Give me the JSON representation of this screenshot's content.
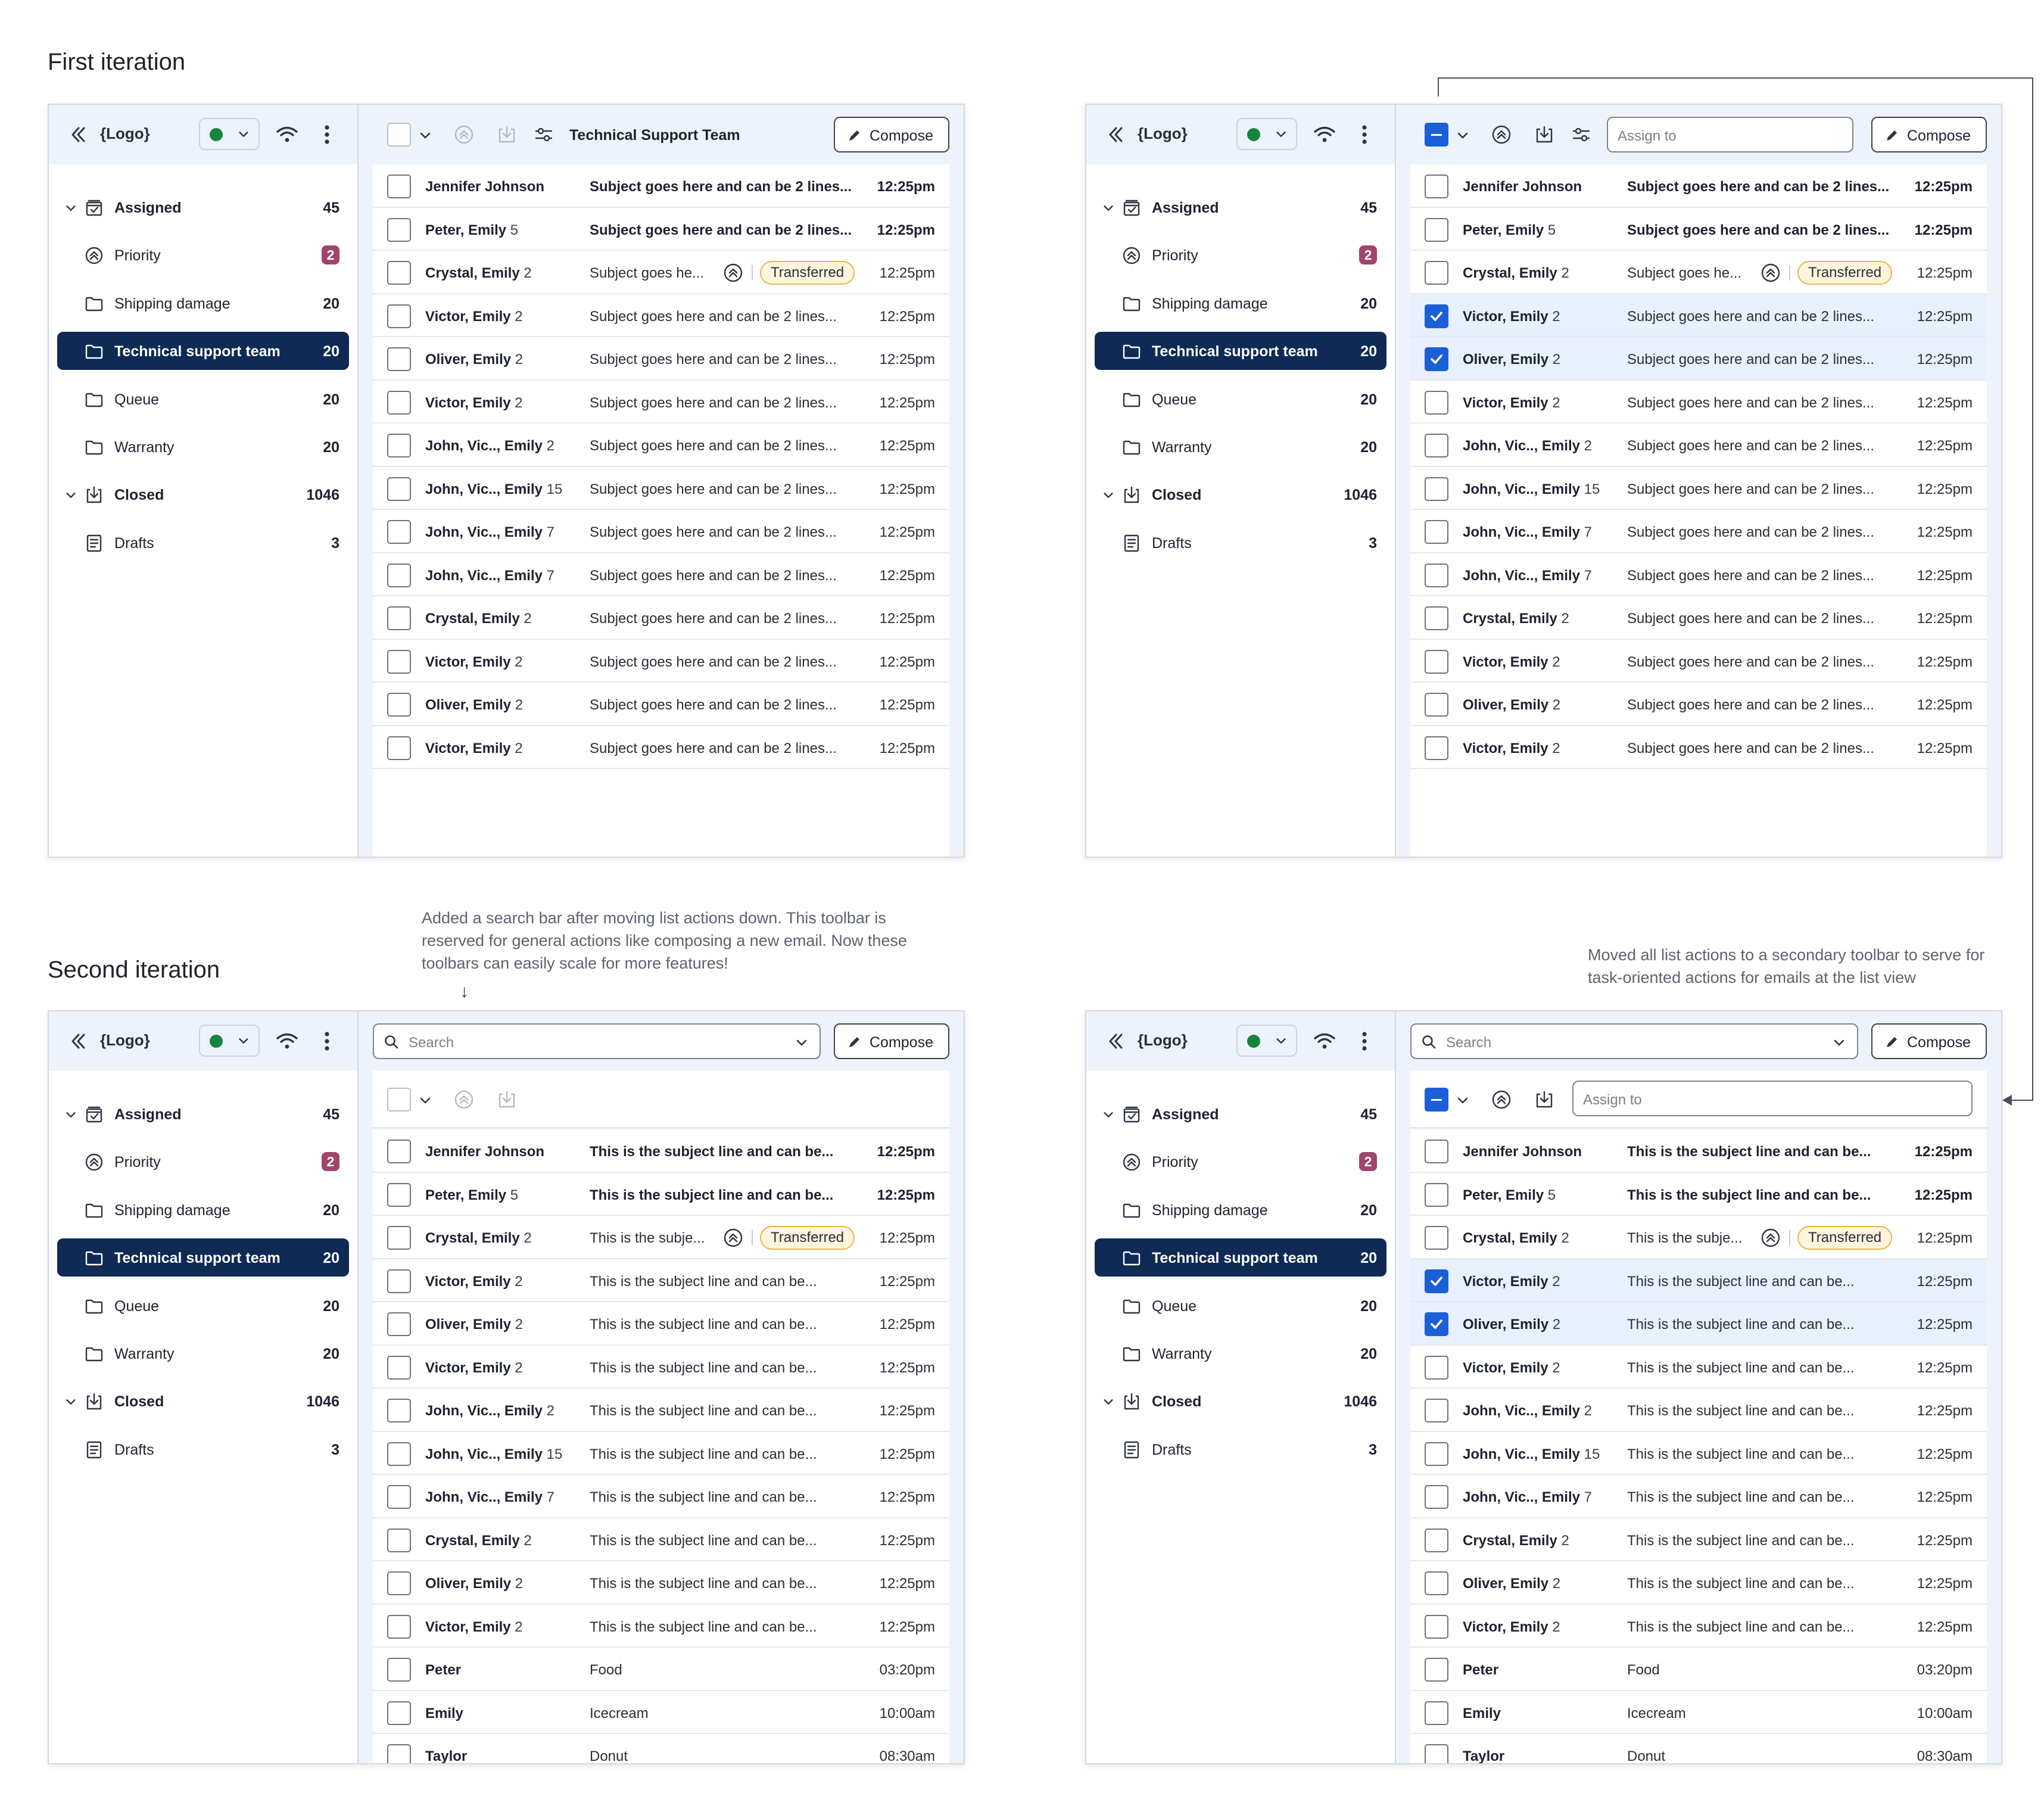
{
  "headings": {
    "first": "First iteration",
    "second": "Second iteration"
  },
  "notes": {
    "search": "Added a search bar after moving list actions down. This toolbar is reserved for general actions like composing a new email. Now these toolbars can easily scale for more features!",
    "toolbar": "Moved all list actions to a secondary toolbar to serve for task-oriented actions for emails at the list view",
    "arrow": "↓"
  },
  "app": {
    "logo": "{Logo}",
    "compose": "Compose",
    "team_title": "Technical Support Team",
    "assign_placeholder": "Assign to",
    "search_placeholder": "Search",
    "badge": "Transferred",
    "status_color": "#17843b",
    "accent": "#1b5fd6",
    "nav_active": "#0e2a55"
  },
  "nav": [
    {
      "label": "Assigned",
      "count": "45",
      "icon": "inbox-icon",
      "kind": "root"
    },
    {
      "label": "Priority",
      "count": "2",
      "icon": "priority-icon",
      "kind": "child",
      "pill": true
    },
    {
      "label": "Shipping damage",
      "count": "20",
      "icon": "folder-icon",
      "kind": "child"
    },
    {
      "label": "Technical support team",
      "count": "20",
      "icon": "folder-icon",
      "kind": "child",
      "active": true
    },
    {
      "label": "Queue",
      "count": "20",
      "icon": "folder-icon",
      "kind": "child"
    },
    {
      "label": "Warranty",
      "count": "20",
      "icon": "folder-icon",
      "kind": "child"
    },
    {
      "label": "Closed",
      "count": "1046",
      "icon": "archive-icon",
      "kind": "root"
    },
    {
      "label": "Drafts",
      "count": "3",
      "icon": "drafts-icon",
      "kind": "plain"
    }
  ],
  "emails_first": [
    {
      "sender": "Jennifer Johnson",
      "n": "",
      "subject": "Subject goes here and can be 2 lines...",
      "time": "12:25pm",
      "unread": true
    },
    {
      "sender": "Peter, Emily",
      "n": "5",
      "subject": "Subject goes here and can be 2 lines...",
      "time": "12:25pm",
      "unread": true
    },
    {
      "sender": "Crystal, Emily",
      "n": "2",
      "subject": "Subject goes he...",
      "time": "12:25pm",
      "transferred": true
    },
    {
      "sender": "Victor, Emily",
      "n": "2",
      "subject": "Subject goes here and can be 2 lines...",
      "time": "12:25pm"
    },
    {
      "sender": "Oliver, Emily",
      "n": "2",
      "subject": "Subject goes here and can be 2 lines...",
      "time": "12:25pm"
    },
    {
      "sender": "Victor, Emily",
      "n": "2",
      "subject": "Subject goes here and can be 2 lines...",
      "time": "12:25pm"
    },
    {
      "sender": "John, Vic.., Emily",
      "n": "2",
      "subject": "Subject goes here and can be 2 lines...",
      "time": "12:25pm"
    },
    {
      "sender": "John, Vic.., Emily",
      "n": "15",
      "subject": "Subject goes here and can be 2 lines...",
      "time": "12:25pm"
    },
    {
      "sender": "John, Vic.., Emily",
      "n": "7",
      "subject": "Subject goes here and can be 2 lines...",
      "time": "12:25pm"
    },
    {
      "sender": "John, Vic.., Emily",
      "n": "7",
      "subject": "Subject goes here and can be 2 lines...",
      "time": "12:25pm"
    },
    {
      "sender": "Crystal, Emily",
      "n": "2",
      "subject": "Subject goes here and can be 2 lines...",
      "time": "12:25pm"
    },
    {
      "sender": "Victor, Emily",
      "n": "2",
      "subject": "Subject goes here and can be 2 lines...",
      "time": "12:25pm"
    },
    {
      "sender": "Oliver, Emily",
      "n": "2",
      "subject": "Subject goes here and can be 2 lines...",
      "time": "12:25pm"
    },
    {
      "sender": "Victor, Emily",
      "n": "2",
      "subject": "Subject goes here and can be 2 lines...",
      "time": "12:25pm"
    }
  ],
  "emails_second": [
    {
      "sender": "Jennifer Johnson",
      "n": "",
      "subject": "This is the subject line and can be...",
      "time": "12:25pm",
      "unread": true
    },
    {
      "sender": "Peter, Emily",
      "n": "5",
      "subject": "This is the subject line and can be...",
      "time": "12:25pm",
      "unread": true
    },
    {
      "sender": "Crystal, Emily",
      "n": "2",
      "subject": "This is the subje...",
      "time": "12:25pm",
      "transferred": true
    },
    {
      "sender": "Victor, Emily",
      "n": "2",
      "subject": "This is the subject line and can be...",
      "time": "12:25pm"
    },
    {
      "sender": "Oliver, Emily",
      "n": "2",
      "subject": "This is the subject line and can be...",
      "time": "12:25pm"
    },
    {
      "sender": "Victor, Emily",
      "n": "2",
      "subject": "This is the subject line and can be...",
      "time": "12:25pm"
    },
    {
      "sender": "John, Vic.., Emily",
      "n": "2",
      "subject": "This is the subject line and can be...",
      "time": "12:25pm"
    },
    {
      "sender": "John, Vic.., Emily",
      "n": "15",
      "subject": "This is the subject line and can be...",
      "time": "12:25pm"
    },
    {
      "sender": "John, Vic.., Emily",
      "n": "7",
      "subject": "This is the subject line and can be...",
      "time": "12:25pm"
    },
    {
      "sender": "Crystal, Emily",
      "n": "2",
      "subject": "This is the subject line and can be...",
      "time": "12:25pm"
    },
    {
      "sender": "Oliver, Emily",
      "n": "2",
      "subject": "This is the subject line and can be...",
      "time": "12:25pm"
    },
    {
      "sender": "Victor, Emily",
      "n": "2",
      "subject": "This is the subject line and can be...",
      "time": "12:25pm"
    },
    {
      "sender": "Peter",
      "n": "",
      "subject": "Food",
      "time": "03:20pm"
    },
    {
      "sender": "Emily",
      "n": "",
      "subject": "Icecream",
      "time": "10:00am"
    },
    {
      "sender": "Taylor",
      "n": "",
      "subject": "Donut",
      "time": "08:30am"
    }
  ],
  "mockups": [
    {
      "id": "first-iteration-default",
      "variant": "first",
      "toolbar": "actions",
      "list": "emails_first",
      "selected": []
    },
    {
      "id": "first-iteration-selected",
      "variant": "first",
      "toolbar": "assign",
      "list": "emails_first",
      "selected": [
        3,
        4
      ]
    },
    {
      "id": "second-iteration-default",
      "variant": "second",
      "toolbar": "search",
      "list": "emails_second",
      "selected": []
    },
    {
      "id": "second-iteration-selected",
      "variant": "second",
      "toolbar": "search-assign",
      "list": "emails_second",
      "selected": [
        3,
        4
      ]
    }
  ]
}
